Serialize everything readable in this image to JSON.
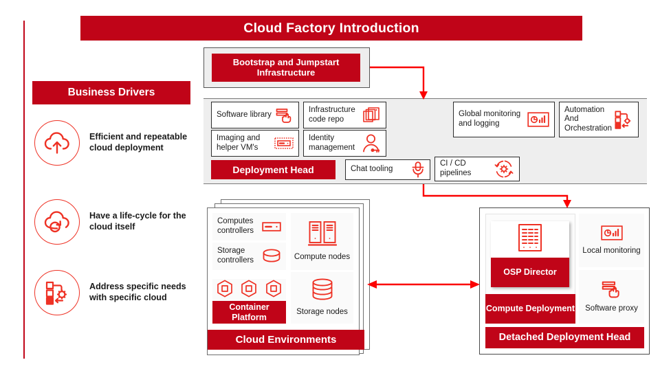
{
  "title": "Cloud Factory Introduction",
  "theme": {
    "brand_red": "#c00418",
    "icon_red": "#ee3124",
    "band_gray": "#eeeeee",
    "text": "#1a1a1a"
  },
  "sidebar": {
    "heading": "Business Drivers",
    "drivers": [
      {
        "icon": "cloud-upload-icon",
        "text": "Efficient and repeatable cloud deployment"
      },
      {
        "icon": "cloud-lifecycle-icon",
        "text": "Have a life-cycle for the cloud itself"
      },
      {
        "icon": "specific-needs-icon",
        "text": "Address specific needs with specific cloud"
      }
    ]
  },
  "bootstrap": {
    "label": "Bootstrap and Jumpstart Infrastructure"
  },
  "deployment_head": {
    "bar_label": "Deployment Head",
    "components": [
      {
        "label": "Software library",
        "icon": "software-library-icon"
      },
      {
        "label": "Infrastructure code repo",
        "icon": "code-repo-icon"
      },
      {
        "label": "Imaging and helper VM's",
        "icon": "imaging-vm-icon"
      },
      {
        "label": "Identity management",
        "icon": "identity-key-icon"
      }
    ],
    "shared_services": [
      {
        "label": "Global monitoring and logging",
        "icon": "monitoring-icon"
      },
      {
        "label": "Automation And Orchestration",
        "icon": "orchestration-icon"
      }
    ],
    "tools": [
      {
        "label": "Chat tooling",
        "icon": "microphone-icon"
      },
      {
        "label": "CI / CD pipelines",
        "icon": "cicd-gear-icon"
      }
    ]
  },
  "cloud_environments": {
    "bar_label": "Cloud Environments",
    "container_bar_label": "Container Platform",
    "left_items": [
      {
        "label": "Computes controllers",
        "icon": "server-controller-icon"
      },
      {
        "label": "Storage controllers",
        "icon": "disk-icon"
      }
    ],
    "container_icons": [
      "container-hex-icon",
      "container-hex-icon",
      "container-hex-icon"
    ],
    "right_items": [
      {
        "label": "Compute nodes",
        "icon": "compute-nodes-icon"
      },
      {
        "label": "Storage nodes",
        "icon": "storage-nodes-icon"
      }
    ]
  },
  "detached_deployment_head": {
    "bar_label": "Detached Deployment Head",
    "osp_label": "OSP Director",
    "osp_icon": "osp-director-icon",
    "compute_deployment_label": "Compute Deployment",
    "right_items": [
      {
        "label": "Local monitoring",
        "icon": "monitoring-icon"
      },
      {
        "label": "Software proxy",
        "icon": "software-library-icon"
      }
    ]
  },
  "connectors": [
    {
      "name": "bootstrap-to-deployment-head",
      "style": "elbow-down-arrow"
    },
    {
      "name": "deployment-head-to-detached",
      "style": "elbow-down-arrow"
    },
    {
      "name": "cloud-env-to-detached",
      "style": "double-headed-arrow"
    }
  ]
}
